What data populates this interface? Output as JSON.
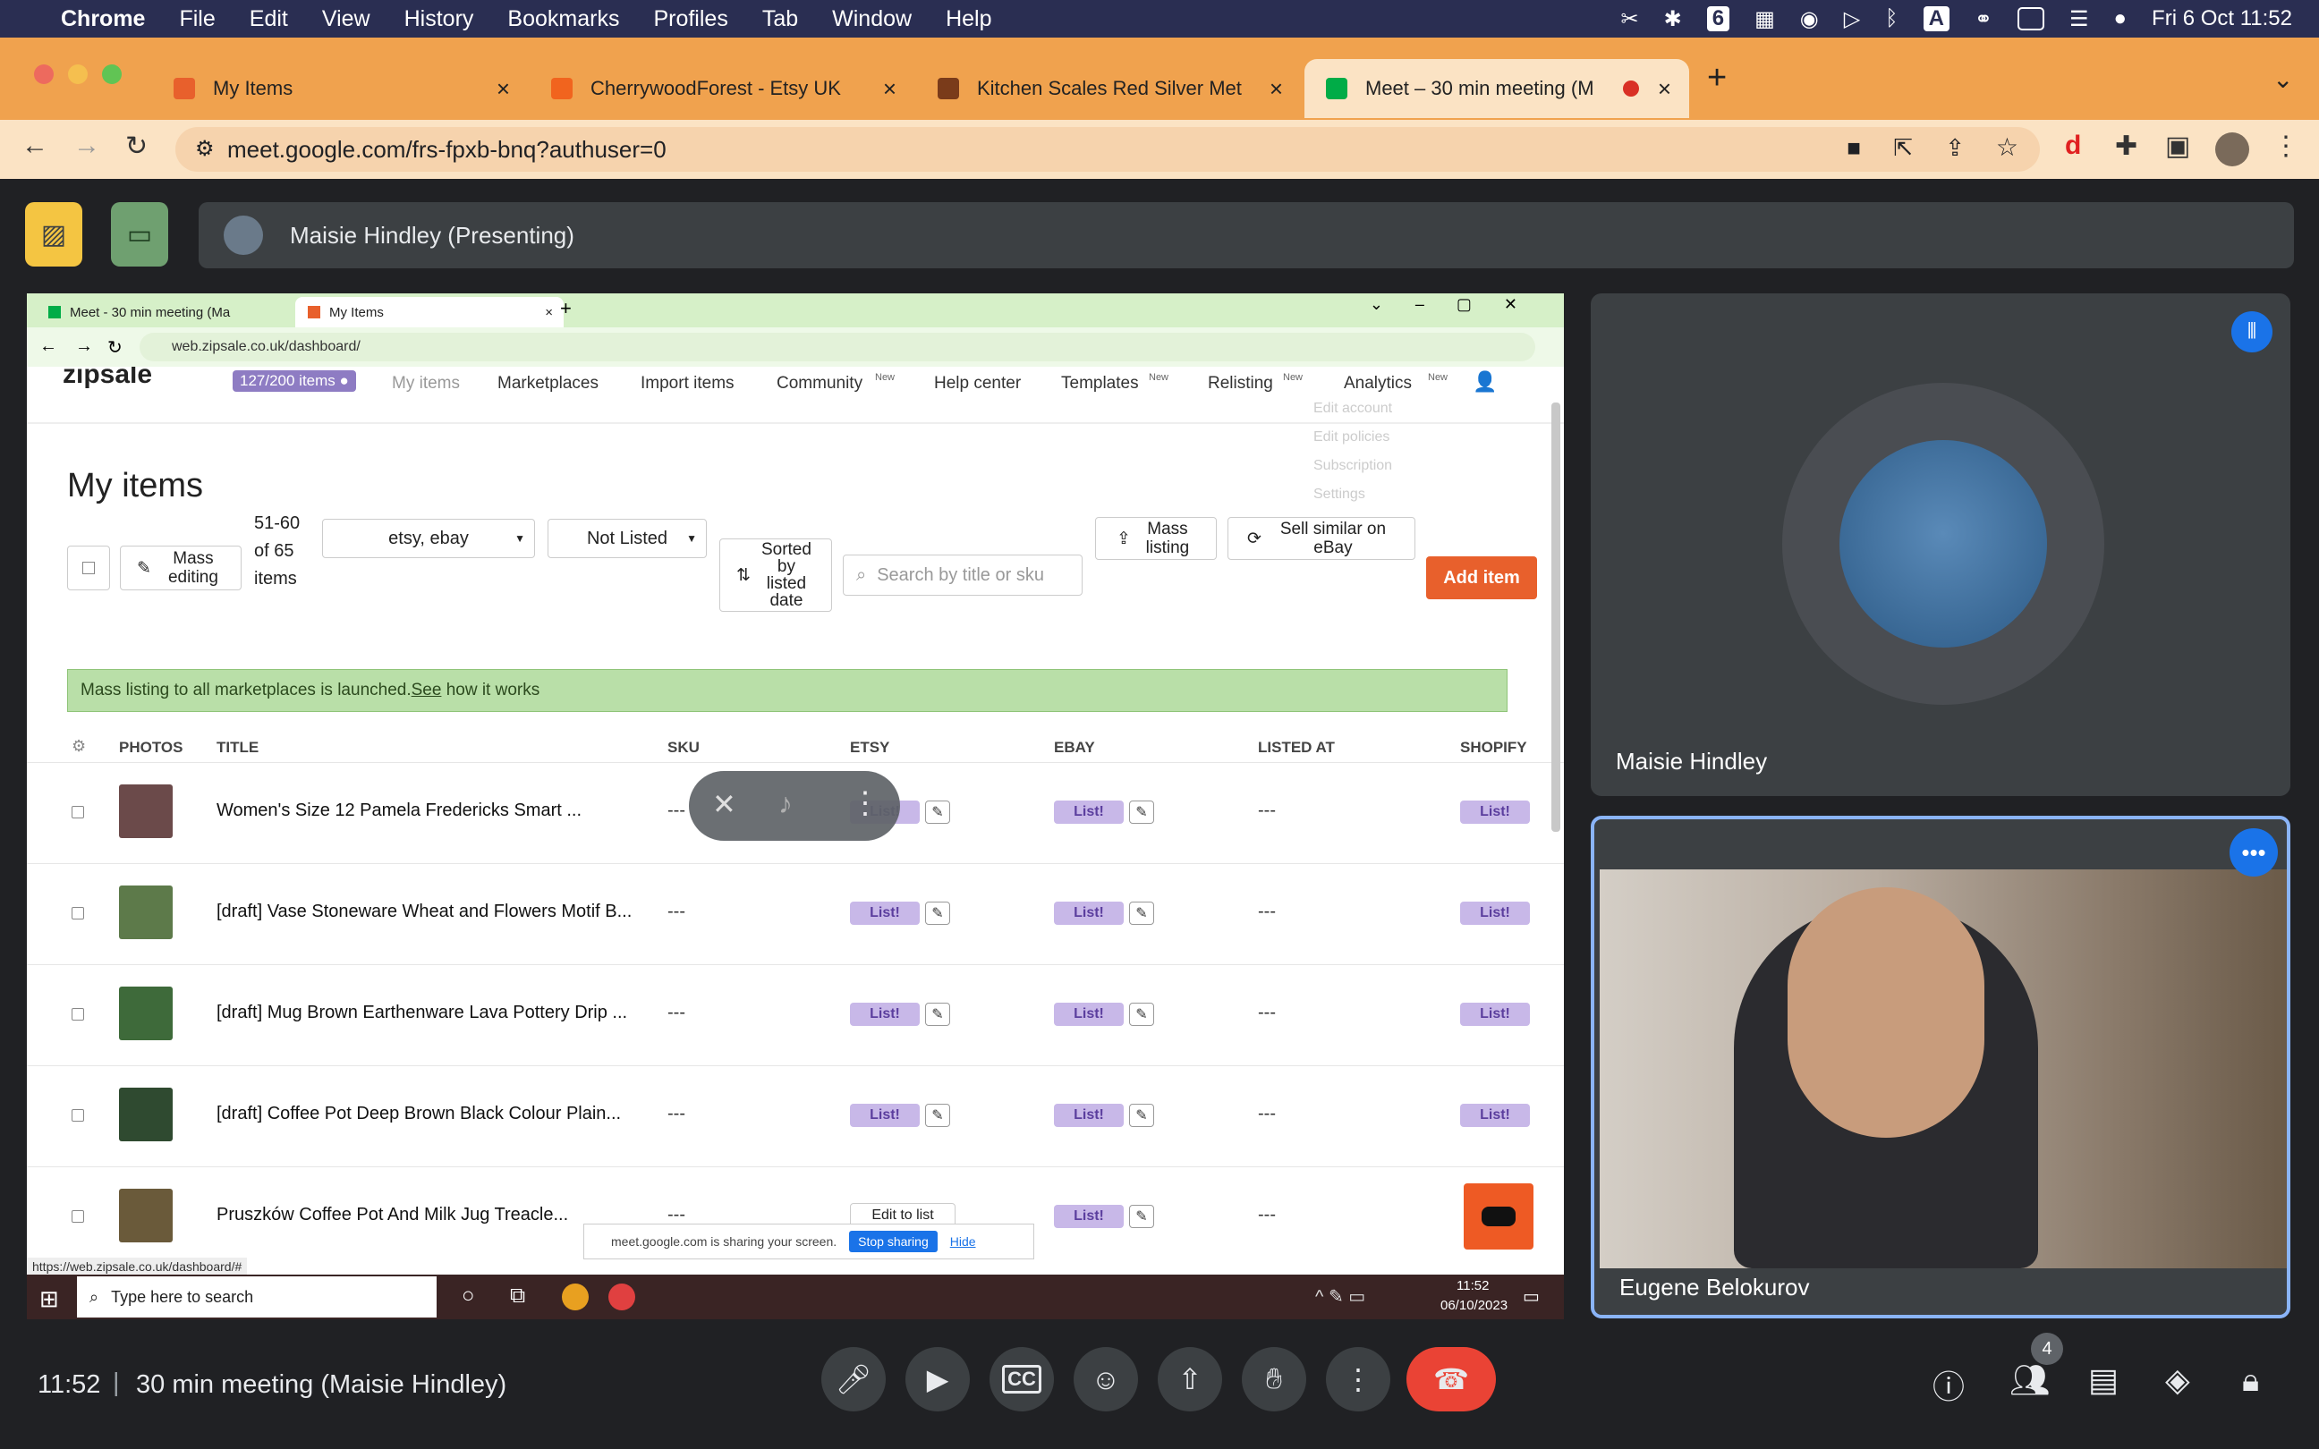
{
  "menubar": {
    "app": "Chrome",
    "items": [
      "File",
      "Edit",
      "View",
      "History",
      "Bookmarks",
      "Profiles",
      "Tab",
      "Window",
      "Help"
    ],
    "clock": "Fri 6 Oct  11:52",
    "badge": "6"
  },
  "browser": {
    "tabs": [
      {
        "title": "My Items"
      },
      {
        "title": "CherrywoodForest - Etsy UK"
      },
      {
        "title": "Kitchen Scales Red Silver Met"
      },
      {
        "title": "Meet – 30 min meeting (M"
      }
    ],
    "url": "meet.google.com/frs-fpxb-bnq?authuser=0",
    "tab_close": "×",
    "new_tab": "+"
  },
  "meet": {
    "presenter_bar": "Maisie Hindley (Presenting)",
    "tiles": [
      {
        "name": "Maisie Hindley"
      },
      {
        "name": "Eugene Belokurov"
      }
    ],
    "time": "11:52",
    "separator": "|",
    "meeting_title": "30 min meeting (Maisie Hindley)",
    "people_count": "4"
  },
  "shared": {
    "window_tabs": [
      "Meet - 30 min meeting (Ma",
      "My Items"
    ],
    "url": "web.zipsale.co.uk/dashboard/",
    "nav": {
      "logo": "zipsale",
      "items_badge": "127/200 items",
      "links": [
        "My items",
        "Marketplaces",
        "Import items",
        "Community",
        "Help center",
        "Templates",
        "Relisting",
        "Analytics"
      ],
      "new_tag": "New",
      "dropdown": [
        "Edit account",
        "Edit policies",
        "Subscription",
        "Settings"
      ]
    },
    "heading": "My items",
    "toolbar": {
      "mass_editing": "Mass editing",
      "count": "51-60 of 65 items",
      "marketplace_filter": "etsy, ebay",
      "status_filter": "Not Listed",
      "sort": "Sorted by listed date",
      "search_placeholder": "Search by title or sku",
      "mass_listing": "Mass listing",
      "sell_similar": "Sell similar on eBay",
      "add_item": "Add item"
    },
    "banner": {
      "text": "Mass listing to all marketplaces is launched.",
      "link": "See",
      "suffix": " how it works"
    },
    "columns": [
      "PHOTOS",
      "TITLE",
      "SKU",
      "ETSY",
      "EBAY",
      "LISTED AT",
      "SHOPIFY"
    ],
    "rows": [
      {
        "title": "Women's Size 12 Pamela Fredericks Smart ...",
        "sku": "---",
        "etsy": "List!",
        "ebay": "List!",
        "listed_at": "---",
        "shopify": "List!"
      },
      {
        "title": "[draft] Vase Stoneware Wheat and Flowers Motif B...",
        "sku": "---",
        "etsy": "List!",
        "ebay": "List!",
        "listed_at": "---",
        "shopify": "List!"
      },
      {
        "title": "[draft] Mug Brown Earthenware Lava Pottery Drip ...",
        "sku": "---",
        "etsy": "List!",
        "ebay": "List!",
        "listed_at": "---",
        "shopify": "List!"
      },
      {
        "title": "[draft] Coffee Pot Deep Brown Black Colour Plain...",
        "sku": "---",
        "etsy": "List!",
        "ebay": "List!",
        "listed_at": "---",
        "shopify": "List!"
      },
      {
        "title": "Pruszków Coffee Pot And Milk Jug Treacle...",
        "sku": "---",
        "etsy": "Edit to list",
        "ebay": "List!",
        "listed_at": "---",
        "shopify": ""
      }
    ],
    "status_url": "https://web.zipsale.co.uk/dashboard/#",
    "sharing_bar": {
      "text": "meet.google.com is sharing your screen.",
      "stop": "Stop sharing",
      "hide": "Hide"
    },
    "taskbar": {
      "search": "Type here to search",
      "time": "11:52",
      "date": "06/10/2023"
    }
  }
}
